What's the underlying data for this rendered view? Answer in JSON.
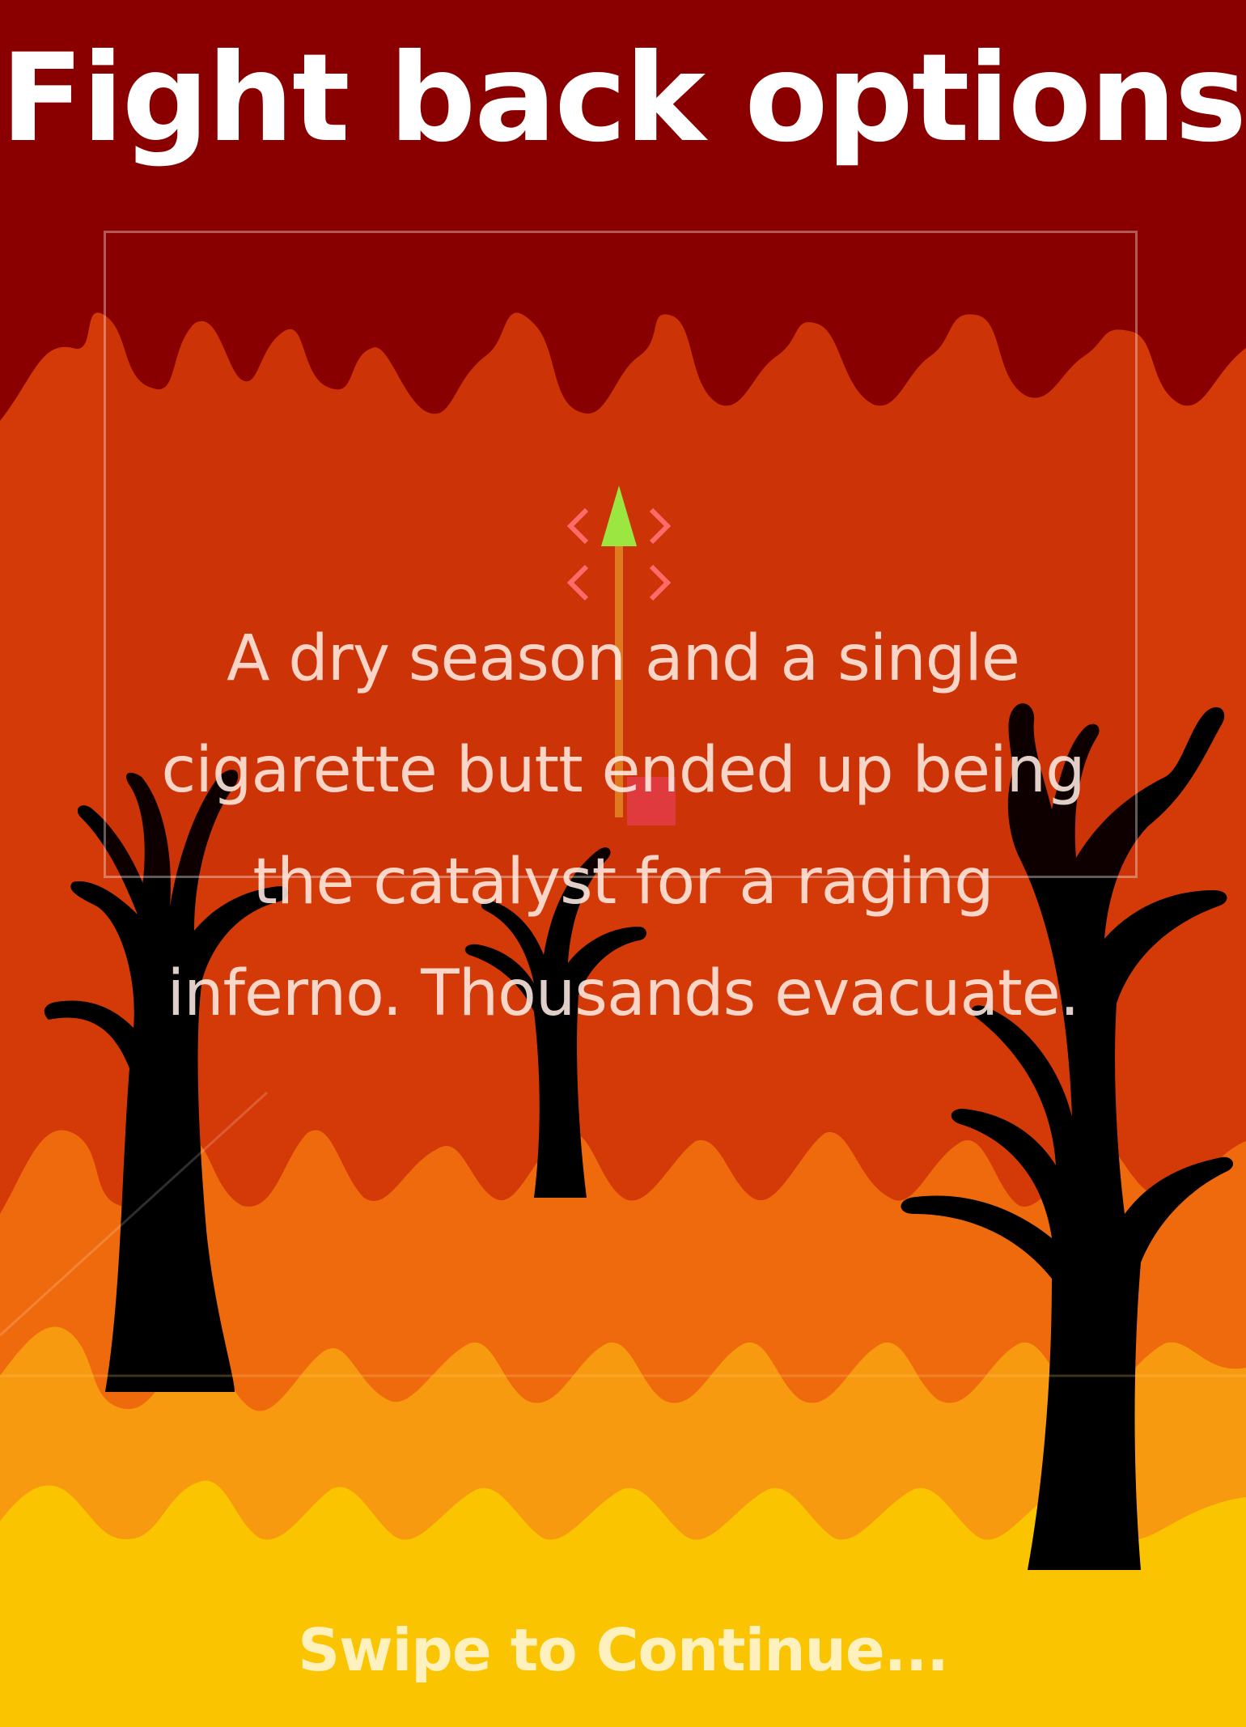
{
  "screen": {
    "title": "Fight back options",
    "story_text": "A dry season and a single cigarette butt ended up being the catalyst for a raging inferno. Thousands evacuate.",
    "swipe_prompt": "Swipe to Continue..."
  },
  "icons": {
    "transform_gizmo": "move-arrow-icon",
    "trees": "burnt-tree-icon"
  },
  "colors": {
    "sky": "#8a0000",
    "flame_back": "#d43a08",
    "flame_mid": "#ef6a0c",
    "flame_front": "#f89a10",
    "flame_base": "#fbc400",
    "tree": "#000000",
    "text": "#ffffff"
  }
}
